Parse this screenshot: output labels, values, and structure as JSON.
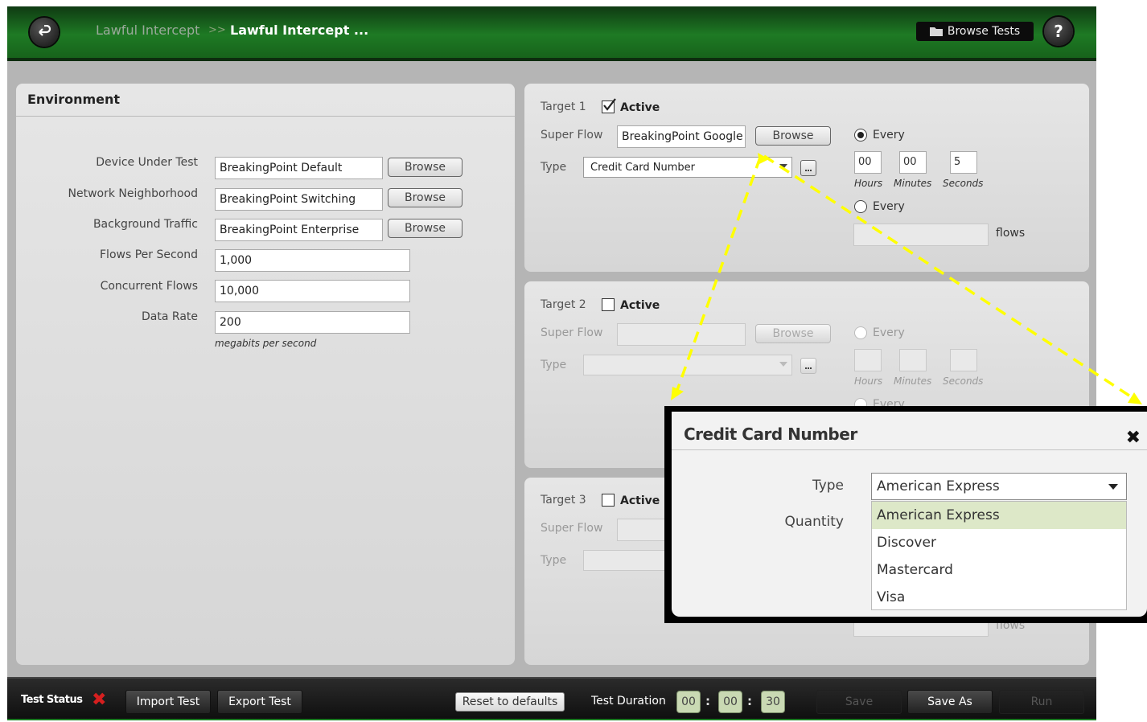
{
  "header": {
    "breadcrumb_parent": "Lawful Intercept",
    "breadcrumb_separator": ">>",
    "breadcrumb_current": "Lawful Intercept ...",
    "browse_tests_label": "Browse Tests",
    "help_label": "?"
  },
  "environment": {
    "title": "Environment",
    "browse_label": "Browse",
    "fields": [
      {
        "label": "Device Under Test",
        "value": "BreakingPoint Default"
      },
      {
        "label": "Network Neighborhood",
        "value": "BreakingPoint Switching"
      },
      {
        "label": "Background Traffic",
        "value": "BreakingPoint Enterprise"
      },
      {
        "label": "Flows Per Second",
        "value": "1,000"
      },
      {
        "label": "Concurrent Flows",
        "value": "10,000"
      },
      {
        "label": "Data Rate",
        "value": "200"
      }
    ],
    "data_rate_unit": "megabits per second"
  },
  "targets": [
    {
      "label": "Target 1",
      "active_label": "Active",
      "active": true,
      "super_flow_label": "Super Flow",
      "super_flow_value": "BreakingPoint Google M",
      "browse_label": "Browse",
      "type_label": "Type",
      "type_value": "Credit Card Number",
      "every_label": "Every",
      "hours": "00",
      "minutes": "00",
      "seconds": "5",
      "hours_unit": "Hours",
      "minutes_unit": "Minutes",
      "seconds_unit": "Seconds",
      "every2_label": "Every",
      "flows_value": "",
      "flows_label": "flows"
    },
    {
      "label": "Target 2",
      "active_label": "Active",
      "active": false,
      "super_flow_label": "Super Flow",
      "browse_label": "Browse",
      "type_label": "Type",
      "every_label": "Every",
      "hours_unit": "Hours",
      "minutes_unit": "Minutes",
      "seconds_unit": "Seconds",
      "every2_label": "Every"
    },
    {
      "label": "Target 3",
      "active_label": "Active",
      "active": false,
      "super_flow_label": "Super Flow",
      "type_label": "Type",
      "flows_label": "flows"
    }
  ],
  "modal": {
    "title": "Credit Card Number",
    "close_icon": "close-icon",
    "type_label": "Type",
    "quantity_label": "Quantity",
    "selected": "American Express",
    "options": [
      "American Express",
      "Discover",
      "Mastercard",
      "Visa"
    ],
    "highlight_color": "#dde8c8"
  },
  "footer": {
    "test_status_label": "Test Status",
    "status_icon": "error-x-icon",
    "import_label": "Import Test",
    "export_label": "Export Test",
    "reset_label": "Reset to defaults",
    "duration_label": "Test Duration",
    "duration_hours": "00",
    "duration_minutes": "00",
    "duration_seconds": "30",
    "save_label": "Save",
    "save_as_label": "Save As",
    "run_label": "Run"
  },
  "colors": {
    "header_green": "#1e7a24",
    "annotation_arrow": "#ffff00",
    "error_red": "#d61f1f"
  }
}
